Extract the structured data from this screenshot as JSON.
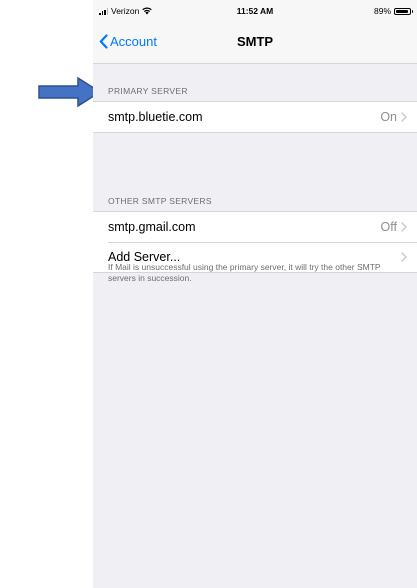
{
  "status_bar": {
    "carrier": "Verizon",
    "time": "11:52 AM",
    "battery_percent": "89%",
    "battery_level": 0.89,
    "icons": [
      "signal-bars-icon",
      "wifi-icon",
      "battery-icon"
    ]
  },
  "nav": {
    "back_label": "Account",
    "title": "SMTP",
    "accent_color": "#007aff"
  },
  "primary_section": {
    "header": "PRIMARY SERVER",
    "items": [
      {
        "label": "smtp.bluetie.com",
        "value": "On"
      }
    ]
  },
  "other_section": {
    "header": "OTHER SMTP SERVERS",
    "items": [
      {
        "label": "smtp.gmail.com",
        "value": "Off"
      },
      {
        "label": "Add Server...",
        "value": ""
      }
    ]
  },
  "footer": {
    "text": "If Mail is unsuccessful using the primary server, it will try the other SMTP servers in succession."
  },
  "annotation": {
    "arrow_color": "#4472c4",
    "arrow_icon": "right-arrow-icon"
  }
}
